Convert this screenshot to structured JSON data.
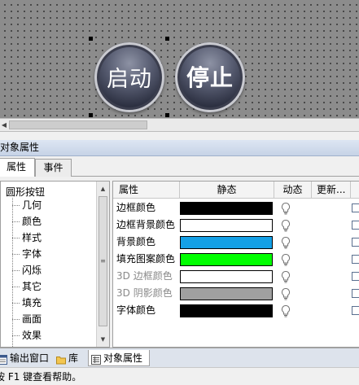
{
  "canvas": {
    "buttons": [
      {
        "label": "启动",
        "selected": true
      },
      {
        "label": "停止",
        "selected": false
      }
    ]
  },
  "panel": {
    "title": "对象属性",
    "tabs": [
      {
        "label": "属性",
        "active": true
      },
      {
        "label": "事件",
        "active": false
      }
    ]
  },
  "tree": {
    "root": "圆形按钮",
    "items": [
      "几何",
      "颜色",
      "样式",
      "字体",
      "闪烁",
      "其它",
      "填充",
      "画面",
      "效果"
    ]
  },
  "grid": {
    "headers": {
      "attr": "属性",
      "static": "静态",
      "dynamic": "动态",
      "update": "更新..."
    },
    "rows": [
      {
        "name": "边框颜色",
        "color": "#000000",
        "dim": false
      },
      {
        "name": "边框背景颜色",
        "color": "#ffffff",
        "dim": false
      },
      {
        "name": "背景颜色",
        "color": "#14a0e6",
        "dim": false
      },
      {
        "name": "填充图案颜色",
        "color": "#00ff00",
        "dim": false
      },
      {
        "name": "3D 边框颜色",
        "color": "#ffffff",
        "dim": true
      },
      {
        "name": "3D 阴影颜色",
        "color": "#a0a0a0",
        "dim": true
      },
      {
        "name": "字体颜色",
        "color": "#000000",
        "dim": false
      }
    ]
  },
  "bottom_tabs": [
    {
      "label": "输出窗口",
      "icon": "output-window-icon",
      "active": false
    },
    {
      "label": "库",
      "icon": "folder-icon",
      "active": false
    },
    {
      "label": "对象属性",
      "icon": "object-properties-icon",
      "active": true
    }
  ],
  "status": {
    "text": "按 F1 键查看帮助。"
  }
}
